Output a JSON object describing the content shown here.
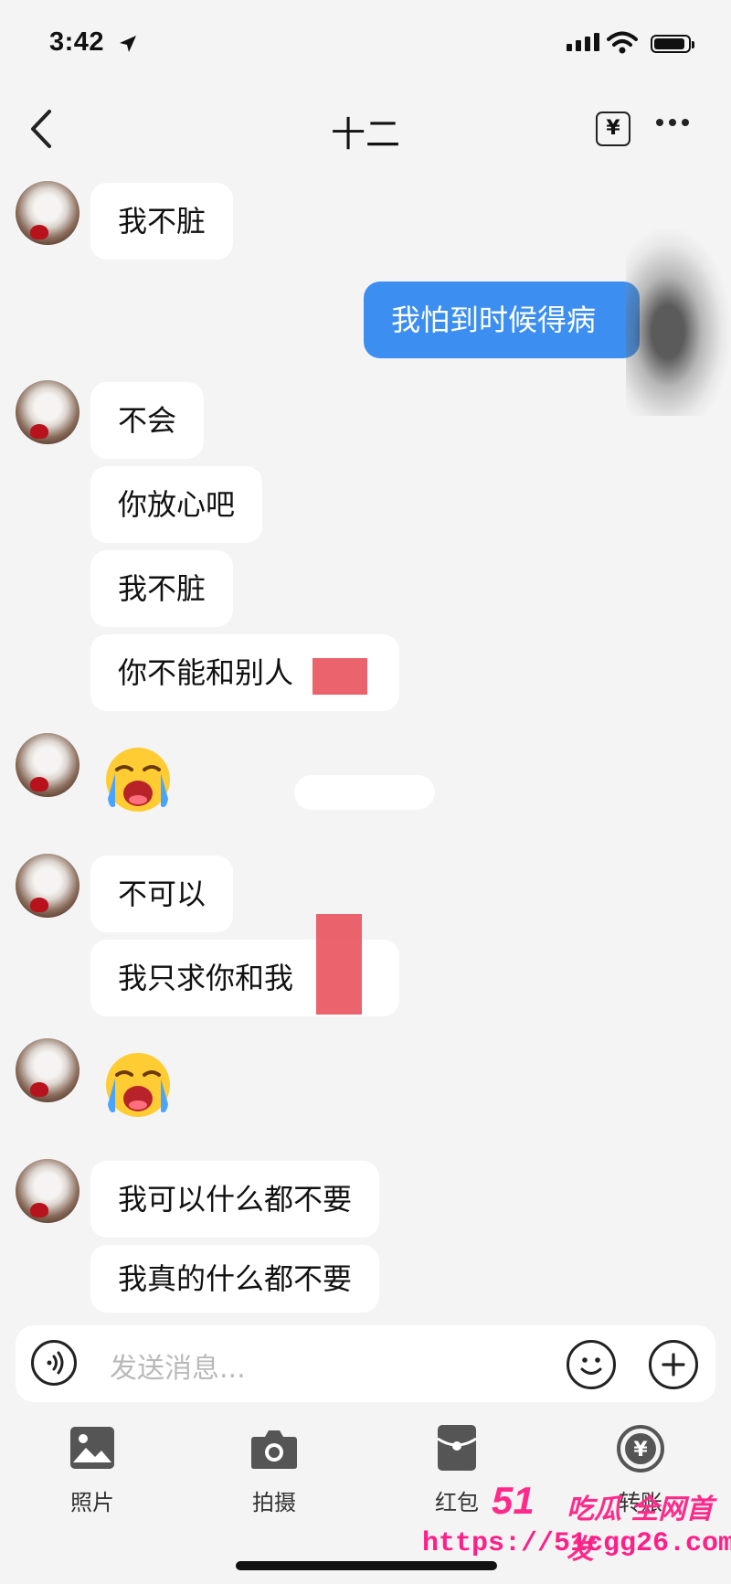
{
  "status_bar": {
    "time": "3:42"
  },
  "header": {
    "title": "十二",
    "transfer_symbol": "¥"
  },
  "messages": [
    {
      "side": "received",
      "text": "我不脏"
    },
    {
      "side": "sent",
      "text": "我怕到时候得病"
    },
    {
      "side": "received",
      "text": "不会"
    },
    {
      "side": "received",
      "text": "你放心吧"
    },
    {
      "side": "received",
      "text": "我不脏"
    },
    {
      "side": "received",
      "text": "你不能和别人"
    },
    {
      "side": "received",
      "emoji": "loudly-crying-face"
    },
    {
      "side": "received",
      "text": "不可以"
    },
    {
      "side": "received",
      "text": "我只求你和我"
    },
    {
      "side": "received",
      "emoji": "loudly-crying-face"
    },
    {
      "side": "received",
      "text": "我可以什么都不要"
    },
    {
      "side": "received",
      "text": "我真的什么都不要"
    }
  ],
  "input": {
    "placeholder": "发送消息..."
  },
  "toolbar": {
    "photos": "照片",
    "camera": "拍摄",
    "red_packet": "红包",
    "transfer": "转账"
  },
  "watermark": {
    "brand": "51",
    "tagline": "吃瓜 全网首发",
    "url": "https://51cgg26.com"
  },
  "colors": {
    "sent_bubble": "#3c8ff0",
    "received_bubble": "#ffffff",
    "background": "#f4f4f4",
    "watermark": "#ff2a8a"
  }
}
